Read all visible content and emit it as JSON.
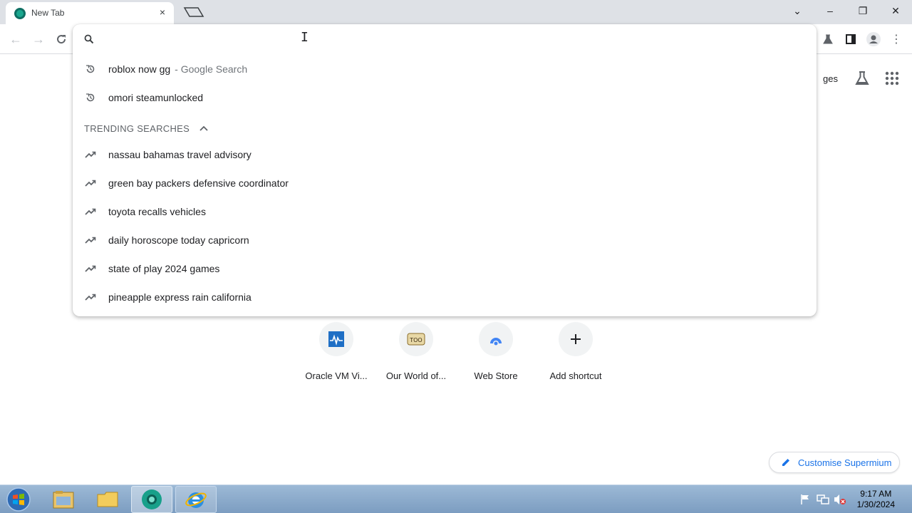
{
  "tab": {
    "title": "New Tab",
    "close": "×"
  },
  "window": {
    "tab_search": "⌄",
    "minimize": "–",
    "restore": "❐",
    "close": "✕"
  },
  "omnibox": {
    "value": "",
    "history": [
      {
        "text": "roblox now gg",
        "suffix": "- Google Search",
        "icon": "history-icon"
      },
      {
        "text": "omori steamunlocked",
        "suffix": "",
        "icon": "history-icon"
      }
    ],
    "trending_header": "TRENDING SEARCHES",
    "trending": [
      {
        "text": "nassau bahamas travel advisory",
        "icon": "trending-icon"
      },
      {
        "text": "green bay packers defensive coordinator",
        "icon": "trending-icon"
      },
      {
        "text": "toyota recalls vehicles",
        "icon": "trending-icon"
      },
      {
        "text": "daily horoscope today capricorn",
        "icon": "trending-icon"
      },
      {
        "text": "state of play 2024 games",
        "icon": "trending-icon"
      },
      {
        "text": "pineapple express rain california",
        "icon": "trending-icon"
      }
    ]
  },
  "ntp": {
    "images_partial": "ges",
    "shortcuts": [
      {
        "label": "Oracle VM Vi...",
        "icon": "virtualbox-icon"
      },
      {
        "label": "Our World of...",
        "icon": "owot-icon"
      },
      {
        "label": "Web Store",
        "icon": "webstore-icon"
      },
      {
        "label": "Add shortcut",
        "icon": "plus-icon"
      }
    ],
    "customise_label": "Customise Supermium"
  },
  "taskbar": {
    "time": "9:17 AM",
    "date": "1/30/2024"
  },
  "colors": {
    "accent": "#1a73e8",
    "tabstrip": "#dee1e6",
    "taskbar": "#8aabcf"
  }
}
